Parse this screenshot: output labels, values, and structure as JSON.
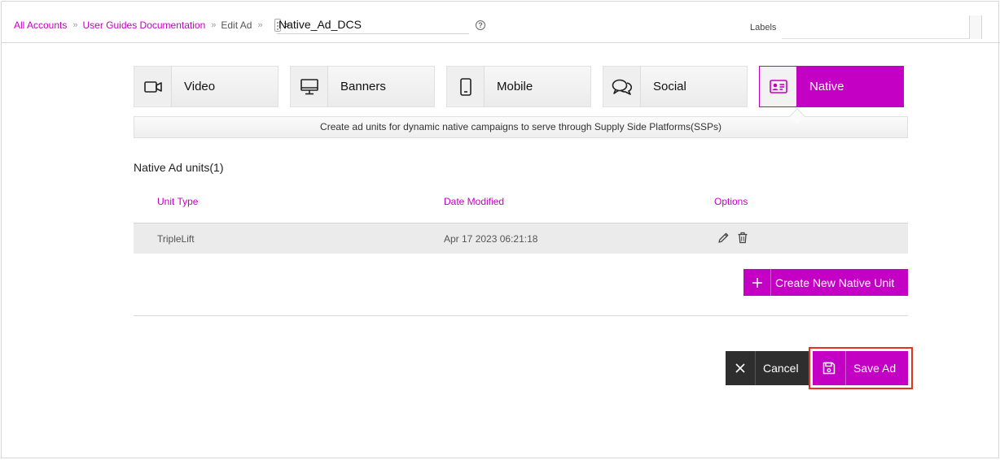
{
  "breadcrumb": {
    "items": [
      "All Accounts",
      "User Guides Documentation",
      "Edit Ad"
    ],
    "separator": "»",
    "gt": ">"
  },
  "ad_name": {
    "value": "Native_Ad_DCS"
  },
  "help": {
    "glyph": "?"
  },
  "labels": {
    "label": "Labels",
    "value": ""
  },
  "tabs": [
    {
      "label": "Video",
      "icon": "video-camera-icon"
    },
    {
      "label": "Banners",
      "icon": "monitor-icon"
    },
    {
      "label": "Mobile",
      "icon": "mobile-phone-icon"
    },
    {
      "label": "Social",
      "icon": "chat-bubbles-icon"
    },
    {
      "label": "Native",
      "icon": "id-card-icon",
      "active": true
    }
  ],
  "description": "Create ad units for dynamic native campaigns to serve through Supply Side Platforms(SSPs)",
  "section_title": "Native Ad units(1)",
  "table": {
    "headers": [
      "Unit Type",
      "Date Modified",
      "Options"
    ],
    "rows": [
      {
        "unit_type": "TripleLift",
        "date_modified": "Apr 17 2023 06:21:18"
      }
    ]
  },
  "create_button": {
    "label": "Create New Native Unit",
    "icon": "plus-icon"
  },
  "cancel_button": {
    "label": "Cancel",
    "icon": "close-icon"
  },
  "save_button": {
    "label": "Save Ad",
    "icon": "floppy-disk-icon"
  },
  "colors": {
    "accent": "#c400c4",
    "link": "#c200c2",
    "highlight": "#e8331c",
    "dark_button": "#2e2e2e"
  }
}
